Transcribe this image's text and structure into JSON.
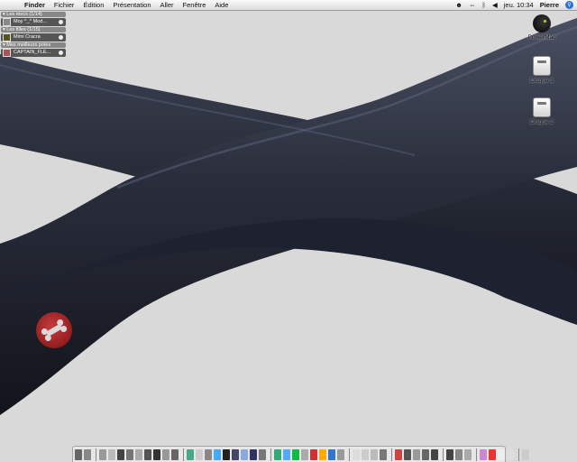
{
  "menubar": {
    "apple_glyph": "",
    "menus": [
      "Finder",
      "Fichier",
      "Édition",
      "Présentation",
      "Aller",
      "Fenêtre",
      "Aide"
    ],
    "clock": "jeu. 10:34",
    "user": "Pierre"
  },
  "messenger": {
    "groups": [
      {
        "label": "Les mecs (1/14)",
        "contact": "Moy ^_^ Mod..."
      },
      {
        "label": "Les filles (1/15)",
        "contact": "Mimi Cracra"
      },
      {
        "label": "Mes meilleurs potes",
        "contact": "CAPTAIN_FLE..."
      }
    ]
  },
  "desktop_icons": [
    {
      "label": "PowerMac",
      "icon": "computer-icon"
    },
    {
      "label": "Disque 1",
      "icon": "hard-disk-icon"
    },
    {
      "label": "Disque 2",
      "icon": "hard-disk-icon"
    }
  ],
  "colors": {
    "wallpaper_bg": "#d9d9d9",
    "tube": "#2a2e3c",
    "badge_red": "#c02828",
    "spotlight_blue": "#2f6fd8"
  },
  "dock": {
    "item_colors": [
      "#666",
      "#888",
      "#999",
      "#bbb",
      "#444",
      "#777",
      "#aaa",
      "#555",
      "#333",
      "#999",
      "#666",
      "#4a8",
      "#ccc",
      "#888",
      "#4af",
      "#222",
      "#446",
      "#8ad",
      "#336",
      "#777",
      "#3a7",
      "#5af",
      "#1b4",
      "#aaa",
      "#c33",
      "#fa0",
      "#37c",
      "#999",
      "#ddd",
      "#ccc",
      "#bbb",
      "#777",
      "#c44",
      "#555",
      "#999",
      "#666",
      "#444",
      "#444",
      "#888",
      "#aaa",
      "#c8c",
      "#e33",
      "#eee",
      "#ddd",
      "#ccc"
    ]
  }
}
